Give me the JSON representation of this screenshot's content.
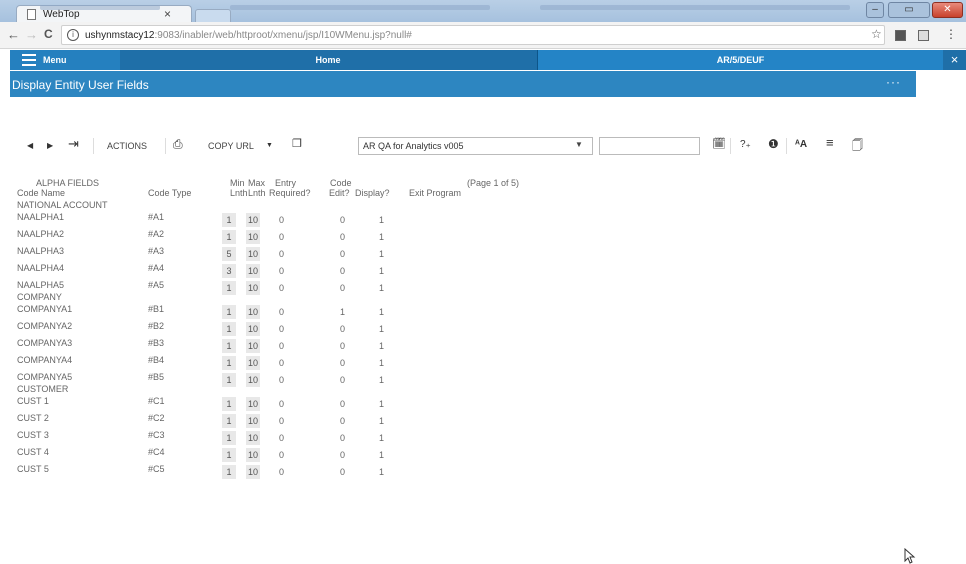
{
  "browser": {
    "tab_title": "WebTop",
    "tab_close": "×",
    "url_host": "ushynmstacy12",
    "url_rest": ":9083/inabler/web/httproot/xmenu/jsp/I10WMenu.jsp?null#",
    "nav": {
      "back": "←",
      "forward": "→",
      "reload": "C"
    }
  },
  "app": {
    "menu_label": "Menu",
    "home_label": "Home",
    "active_tab": "AR/5/DEUF",
    "close_icon": "×",
    "page_title": "Display Entity User Fields",
    "more_icon": "···"
  },
  "toolbar": {
    "actions_label": "ACTIONS",
    "copy_url_label": "COPY URL",
    "dataset_value": "AR QA for Analytics v005",
    "search_value": ""
  },
  "table": {
    "header_top": {
      "alpha": "ALPHA FIELDS",
      "min": "Min",
      "max": "Max",
      "entry": "Entry",
      "code": "Code",
      "page": "(Page 1 of 5)"
    },
    "header_bottom": {
      "code_name": "Code Name",
      "code_type": "Code Type",
      "min": "Lnth",
      "max": "Lnth",
      "entry": "Required?",
      "code": "Edit?",
      "display": "Display?",
      "exit": "Exit Program"
    },
    "groups": [
      {
        "title": "NATIONAL ACCOUNT",
        "rows": [
          {
            "name": "NAALPHA1",
            "type": "#A1",
            "min": "1",
            "max": "10",
            "req": "0",
            "edit": "0",
            "disp": "1"
          },
          {
            "name": "NAALPHA2",
            "type": "#A2",
            "min": "1",
            "max": "10",
            "req": "0",
            "edit": "0",
            "disp": "1"
          },
          {
            "name": "NAALPHA3",
            "type": "#A3",
            "min": "5",
            "max": "10",
            "req": "0",
            "edit": "0",
            "disp": "1"
          },
          {
            "name": "NAALPHA4",
            "type": "#A4",
            "min": "3",
            "max": "10",
            "req": "0",
            "edit": "0",
            "disp": "1"
          },
          {
            "name": "NAALPHA5",
            "type": "#A5",
            "min": "1",
            "max": "10",
            "req": "0",
            "edit": "0",
            "disp": "1"
          }
        ]
      },
      {
        "title": "COMPANY",
        "rows": [
          {
            "name": "COMPANYA1",
            "type": "#B1",
            "min": "1",
            "max": "10",
            "req": "0",
            "edit": "1",
            "disp": "1"
          },
          {
            "name": "COMPANYA2",
            "type": "#B2",
            "min": "1",
            "max": "10",
            "req": "0",
            "edit": "0",
            "disp": "1"
          },
          {
            "name": "COMPANYA3",
            "type": "#B3",
            "min": "1",
            "max": "10",
            "req": "0",
            "edit": "0",
            "disp": "1"
          },
          {
            "name": "COMPANYA4",
            "type": "#B4",
            "min": "1",
            "max": "10",
            "req": "0",
            "edit": "0",
            "disp": "1"
          },
          {
            "name": "COMPANYA5",
            "type": "#B5",
            "min": "1",
            "max": "10",
            "req": "0",
            "edit": "0",
            "disp": "1"
          }
        ]
      },
      {
        "title": "CUSTOMER",
        "rows": [
          {
            "name": "CUST 1",
            "type": "#C1",
            "min": "1",
            "max": "10",
            "req": "0",
            "edit": "0",
            "disp": "1"
          },
          {
            "name": "CUST 2",
            "type": "#C2",
            "min": "1",
            "max": "10",
            "req": "0",
            "edit": "0",
            "disp": "1"
          },
          {
            "name": "CUST 3",
            "type": "#C3",
            "min": "1",
            "max": "10",
            "req": "0",
            "edit": "0",
            "disp": "1"
          },
          {
            "name": "CUST 4",
            "type": "#C4",
            "min": "1",
            "max": "10",
            "req": "0",
            "edit": "0",
            "disp": "1"
          },
          {
            "name": "CUST 5",
            "type": "#C5",
            "min": "1",
            "max": "10",
            "req": "0",
            "edit": "0",
            "disp": "1"
          }
        ]
      }
    ]
  },
  "colors": {
    "nav_dark": "#1f6fa8",
    "title_strip": "#2d86c1",
    "active_tab": "#2484c6",
    "field_box": "#e8e8e8"
  },
  "icons": [
    "menu-icon",
    "prev-icon",
    "next-icon",
    "exit-icon",
    "print-icon",
    "dropdown-icon",
    "clipboard-icon",
    "calendar-icon",
    "help-icon",
    "info-icon",
    "font-size-icon",
    "list-icon",
    "attachment-icon",
    "cursor-icon"
  ]
}
